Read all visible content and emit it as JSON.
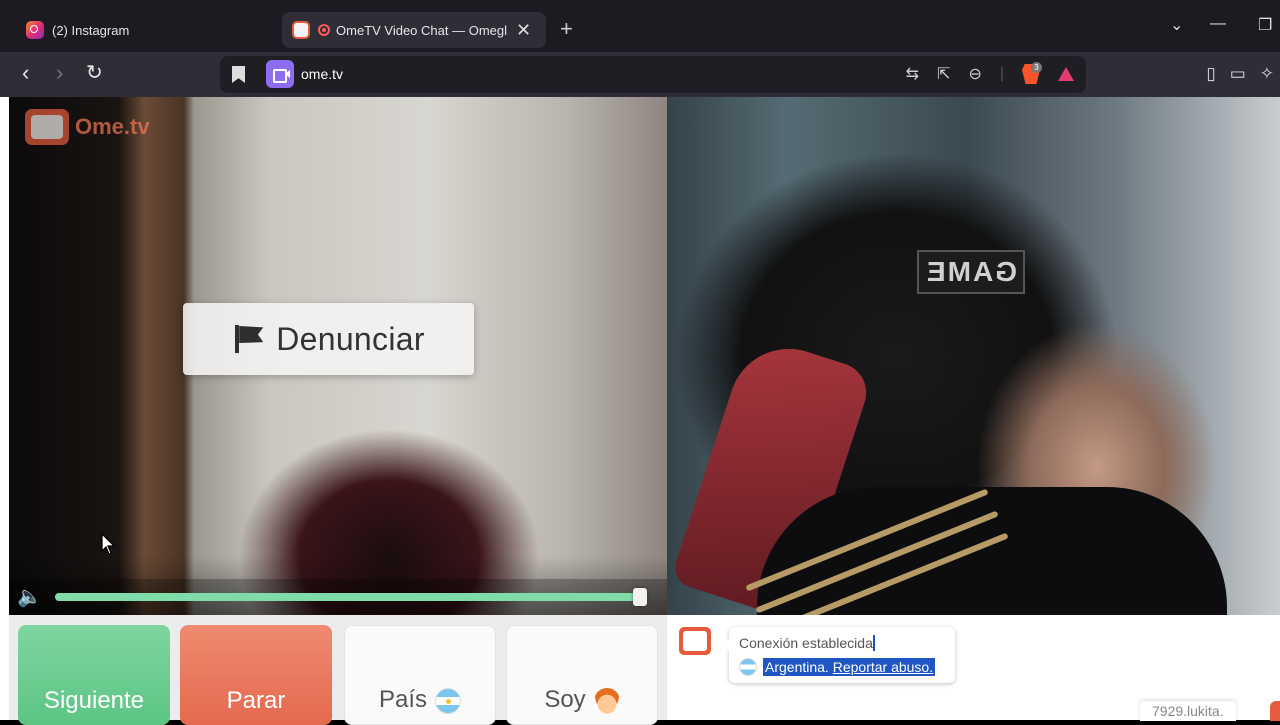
{
  "browser": {
    "tabs": [
      {
        "title": "(2) Instagram",
        "active": false
      },
      {
        "title": "OmeTV Video Chat — Omegl",
        "active": true
      }
    ],
    "new_tab": "+",
    "url": "ome.tv",
    "shields_count": "3",
    "colors": {
      "tabbar": "#1c1b22",
      "toolbar": "#2f2e36",
      "brave": "#fb542b"
    }
  },
  "video": {
    "logo_text": "Ome.tv",
    "report_label": "Denunciar",
    "chair_text": "GAME",
    "volume_level": 1.0
  },
  "controls": {
    "next_label": "Siguiente",
    "stop_label": "Parar",
    "country_label": "País",
    "me_label": "Soy",
    "colors": {
      "next": "#5cc584",
      "stop": "#e36a4f"
    }
  },
  "chat": {
    "status": "Conexión establecida",
    "country": "Argentina.",
    "report_link": "Reportar abuso.",
    "footer_user": "7929.lukita."
  }
}
